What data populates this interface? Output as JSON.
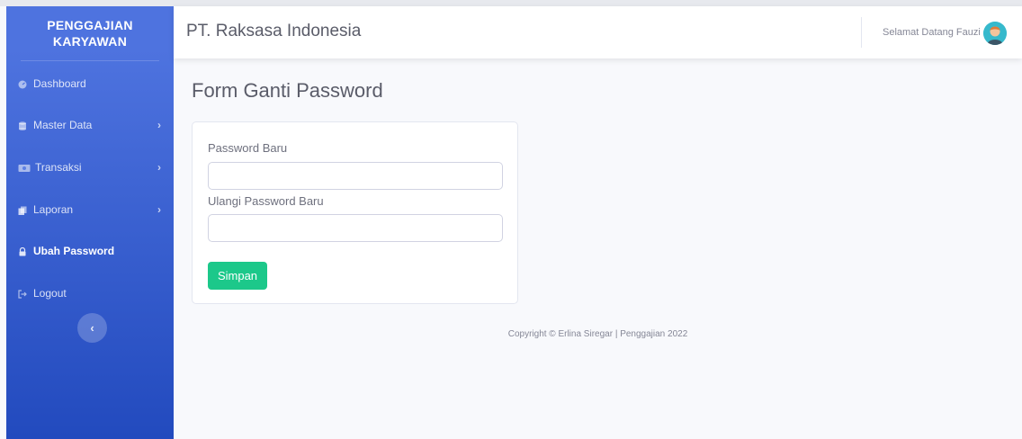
{
  "sidebar": {
    "brand_line1": "PENGGAJIAN",
    "brand_line2": "KARYAWAN",
    "items": [
      {
        "label": "Dashboard",
        "icon": "tachometer-icon"
      },
      {
        "label": "Master Data",
        "icon": "database-icon",
        "has_submenu": true
      },
      {
        "label": "Transaksi",
        "icon": "money-bill-icon",
        "has_submenu": true
      },
      {
        "label": "Laporan",
        "icon": "copy-icon",
        "has_submenu": true
      },
      {
        "label": "Ubah Password",
        "icon": "lock-icon",
        "active": true
      },
      {
        "label": "Logout",
        "icon": "sign-out-icon"
      }
    ],
    "chevron": "›",
    "toggle_glyph": "‹"
  },
  "topbar": {
    "company": "PT. Raksasa Indonesia",
    "welcome": "Selamat Datang Fauzi"
  },
  "page": {
    "title": "Form Ganti Password"
  },
  "form": {
    "new_password_label": "Password Baru",
    "new_password_value": "",
    "confirm_password_label": "Ulangi Password Baru",
    "confirm_password_value": "",
    "submit_label": "Simpan"
  },
  "footer": {
    "text": "Copyright © Erlina Siregar | Penggajian 2022"
  },
  "colors": {
    "sidebar_top": "#4e73df",
    "sidebar_bottom": "#224abe",
    "success": "#1cc88a",
    "avatar": "#36b9cc"
  }
}
